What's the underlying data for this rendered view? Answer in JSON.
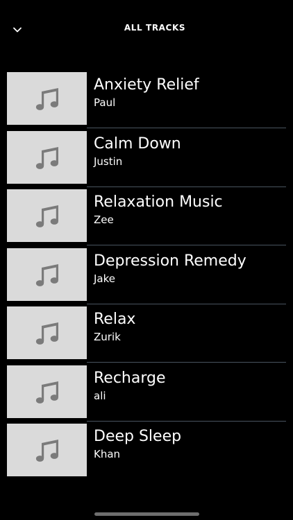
{
  "header": {
    "title": "ALL TRACKS",
    "back_icon": "chevron-down-icon"
  },
  "thumbnail_icon": "music-note-icon",
  "colors": {
    "background": "#000000",
    "thumbnail": "#dadada",
    "note": "#7b7b7b",
    "divider": "#4a5560"
  },
  "tracks": [
    {
      "title": "Anxiety Relief",
      "artist": "Paul"
    },
    {
      "title": "Calm Down",
      "artist": "Justin"
    },
    {
      "title": "Relaxation Music",
      "artist": "Zee"
    },
    {
      "title": "Depression Remedy",
      "artist": "Jake"
    },
    {
      "title": "Relax",
      "artist": "Zurik"
    },
    {
      "title": "Recharge",
      "artist": "ali"
    },
    {
      "title": "Deep Sleep",
      "artist": "Khan"
    }
  ]
}
